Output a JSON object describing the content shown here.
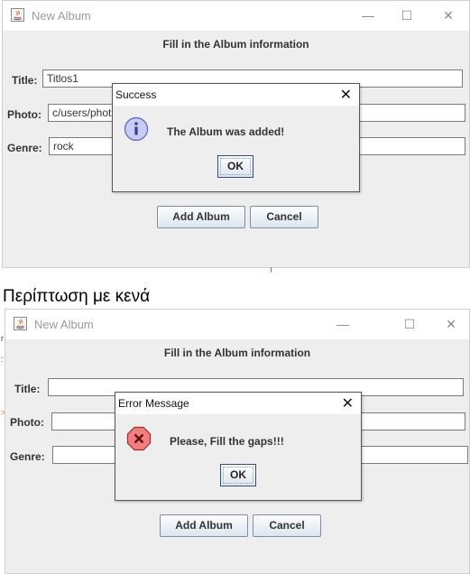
{
  "top": {
    "window_title": "New Album",
    "heading": "Fill in the Album information",
    "fields": [
      {
        "label": "Title:",
        "value": "Titlos1"
      },
      {
        "label": "Photo:",
        "value": "c/users/phot"
      },
      {
        "label": "Genre:",
        "value": "rock"
      }
    ],
    "add_button": "Add Album",
    "cancel_button": "Cancel",
    "dialog": {
      "title": "Success",
      "message": "The Album was added!",
      "ok": "OK",
      "icon": "info-icon",
      "icon_color": "#7b7fd6"
    }
  },
  "caption": "Περίπτωση με κενά",
  "bottom": {
    "window_title": "New Album",
    "heading": "Fill in the Album information",
    "fields": [
      {
        "label": "Title:",
        "value": ""
      },
      {
        "label": "Photo:",
        "value": ""
      },
      {
        "label": "Genre:",
        "value": ""
      }
    ],
    "add_button": "Add Album",
    "cancel_button": "Cancel",
    "dialog": {
      "title": "Error Message",
      "message": "Please, Fill the gaps!!!",
      "ok": "OK",
      "icon": "error-icon",
      "icon_color": "#e05a5a"
    }
  },
  "window_controls": {
    "minimize": "minimize-icon",
    "maximize": "maximize-icon",
    "close": "close-icon"
  },
  "colors": {
    "window_bg": "#eeeeee",
    "titlebar_bg": "#ffffff",
    "button_border": "#7b8fa8"
  }
}
